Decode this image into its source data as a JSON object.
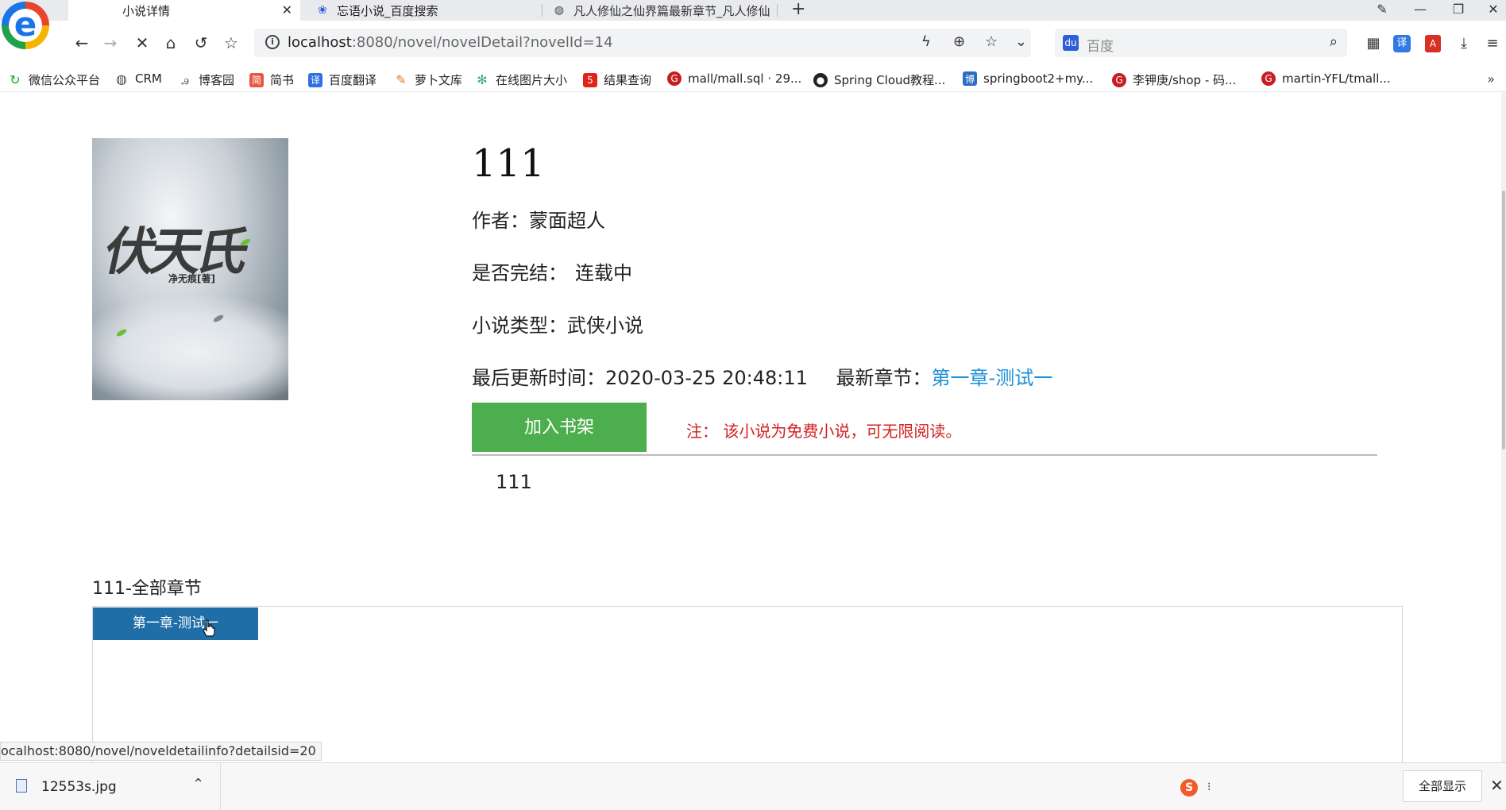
{
  "browser": {
    "tabs": [
      {
        "title": "小说详情"
      },
      {
        "title": "忘语小说_百度搜索"
      },
      {
        "title": "凡人修仙之仙界篇最新章节_凡人修仙"
      }
    ],
    "url_host": "localhost",
    "url_rest": ":8080/novel/novelDetail?novelId=14",
    "search_placeholder": "百度",
    "bookmarks": [
      {
        "label": "微信公众平台",
        "color": "#1aad19"
      },
      {
        "label": "CRM",
        "color": "#444444"
      },
      {
        "label": "博客园",
        "color": "#555555"
      },
      {
        "label": "简书",
        "color": "#e9573f"
      },
      {
        "label": "百度翻译",
        "color": "#2f6fe4"
      },
      {
        "label": "萝卜文库",
        "color": "#e07b1b"
      },
      {
        "label": "在线图片大小",
        "color": "#39a86b"
      },
      {
        "label": "结果查询",
        "color": "#e2231a"
      },
      {
        "label": "mall/mall.sql · 29...",
        "color": "#c71d23"
      },
      {
        "label": "Spring Cloud教程...",
        "color": "#222222"
      },
      {
        "label": "springboot2+my...",
        "color": "#2b6cc4"
      },
      {
        "label": "李钾庚/shop - 码...",
        "color": "#c71d23"
      },
      {
        "label": "martin-YFL/tmall...",
        "color": "#c71d23"
      }
    ]
  },
  "novel": {
    "title": "111",
    "author_label": "作者：",
    "author": "蒙面超人",
    "status_label": "是否完结：",
    "status": "连载中",
    "type_label": "小说类型：",
    "type": "武侠小说",
    "updated_label": "最后更新时间：",
    "updated": "2020-03-25 20:48:11",
    "latest_label": "最新章节：",
    "latest_chapter": "第一章-测试一",
    "shelf_button": "加入书架",
    "note": "注：  该小说为免费小说，可无限阅读。",
    "intro": "111",
    "cover_title": "伏天氏",
    "cover_author": "净无痕[著]"
  },
  "chapters": {
    "heading": "111-全部章节",
    "items": [
      {
        "label": "第一章-测试一"
      }
    ]
  },
  "status_bar_url": "ocalhost:8080/novel/noveldetailinfo?detailsid=20",
  "downloads": {
    "file_name": "12553s.jpg",
    "show_all": "全部显示"
  },
  "colors": {
    "shelf_button": "#4cae4c",
    "chapter_button": "#1f6ea8",
    "note": "#d32020",
    "link": "#1a8fd8"
  }
}
